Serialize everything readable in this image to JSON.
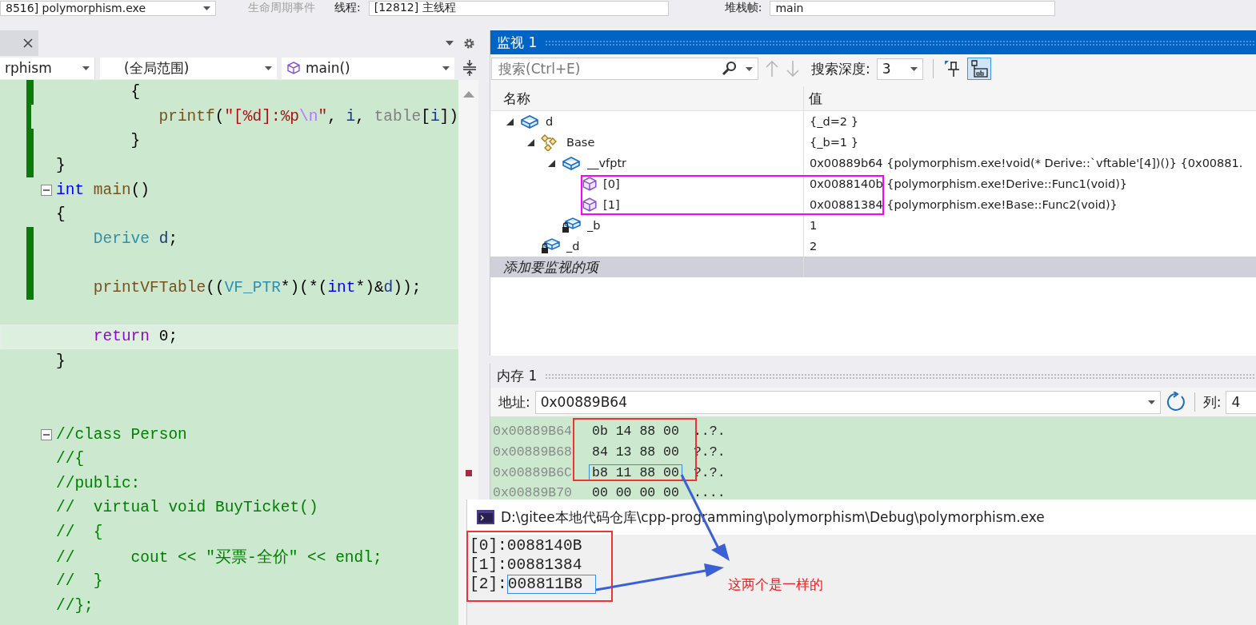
{
  "toolbar": {
    "process": "8516] polymorphism.exe",
    "events": "生命周期事件",
    "thread_label": "线程:",
    "thread": "[12812] 主线程",
    "frame_label": "堆栈帧:",
    "frame": "main"
  },
  "editor": {
    "project": "rphism",
    "scope": "(全局范围)",
    "member": "main()",
    "lines": [
      {
        "changed": true,
        "fold": false,
        "current": false,
        "segments": [
          {
            "kind": "plain",
            "text": "        {"
          }
        ]
      },
      {
        "changed": true,
        "fold": false,
        "current": false,
        "segments": [
          {
            "kind": "fn",
            "text": "            printf"
          },
          {
            "kind": "plain",
            "text": "("
          },
          {
            "kind": "str",
            "text": "\"[%d]:%p"
          },
          {
            "kind": "esc",
            "text": "\\n"
          },
          {
            "kind": "str",
            "text": "\""
          },
          {
            "kind": "plain",
            "text": ", "
          },
          {
            "kind": "ident",
            "text": "i"
          },
          {
            "kind": "plain",
            "text": ", "
          },
          {
            "kind": "field",
            "text": "table"
          },
          {
            "kind": "plain",
            "text": "["
          },
          {
            "kind": "ident",
            "text": "i"
          },
          {
            "kind": "plain",
            "text": "])"
          }
        ]
      },
      {
        "changed": true,
        "fold": false,
        "current": false,
        "segments": [
          {
            "kind": "plain",
            "text": "        }"
          }
        ]
      },
      {
        "changed": true,
        "fold": false,
        "current": false,
        "segments": [
          {
            "kind": "plain",
            "text": "}"
          }
        ]
      },
      {
        "changed": false,
        "fold": true,
        "current": false,
        "segments": [
          {
            "kind": "kw",
            "text": "int"
          },
          {
            "kind": "fn",
            "text": " main"
          },
          {
            "kind": "plain",
            "text": "()"
          }
        ]
      },
      {
        "changed": false,
        "fold": false,
        "current": false,
        "segments": [
          {
            "kind": "plain",
            "text": "{"
          }
        ]
      },
      {
        "changed": true,
        "fold": false,
        "current": false,
        "segments": [
          {
            "kind": "type",
            "text": "    Derive"
          },
          {
            "kind": "ident",
            "text": " d"
          },
          {
            "kind": "plain",
            "text": ";"
          }
        ]
      },
      {
        "changed": true,
        "fold": false,
        "current": false
      },
      {
        "changed": true,
        "fold": false,
        "current": false,
        "segments": [
          {
            "kind": "fn",
            "text": "    printVFTable"
          },
          {
            "kind": "plain",
            "text": "(("
          },
          {
            "kind": "type",
            "text": "VF_PTR"
          },
          {
            "kind": "plain",
            "text": "*)(*("
          },
          {
            "kind": "kw",
            "text": "int"
          },
          {
            "kind": "plain",
            "text": "*)&"
          },
          {
            "kind": "ident",
            "text": "d"
          },
          {
            "kind": "plain",
            "text": "));"
          }
        ]
      },
      {
        "changed": false,
        "fold": false,
        "current": false
      },
      {
        "changed": false,
        "fold": false,
        "current": true,
        "segments": [
          {
            "kind": "ctrl",
            "text": "    return"
          },
          {
            "kind": "plain",
            "text": " 0;"
          }
        ]
      },
      {
        "changed": false,
        "fold": false,
        "current": false,
        "segments": [
          {
            "kind": "plain",
            "text": "}"
          }
        ]
      },
      {
        "changed": false,
        "fold": false,
        "current": false
      },
      {
        "changed": false,
        "fold": false,
        "current": false
      },
      {
        "changed": false,
        "fold": true,
        "current": false,
        "segments": [
          {
            "kind": "comment",
            "text": "//class Person"
          }
        ]
      },
      {
        "changed": false,
        "fold": false,
        "current": false,
        "segments": [
          {
            "kind": "comment",
            "text": "//{"
          }
        ]
      },
      {
        "changed": false,
        "fold": false,
        "current": false,
        "segments": [
          {
            "kind": "comment",
            "text": "//public:"
          }
        ]
      },
      {
        "changed": false,
        "fold": false,
        "current": false,
        "segments": [
          {
            "kind": "comment",
            "text": "//  virtual void BuyTicket()"
          }
        ]
      },
      {
        "changed": false,
        "fold": false,
        "current": false,
        "segments": [
          {
            "kind": "comment",
            "text": "//  {"
          }
        ]
      },
      {
        "changed": false,
        "fold": false,
        "current": false,
        "segments": [
          {
            "kind": "comment",
            "text": "//      cout << \"买票-全价\" << endl;"
          }
        ]
      },
      {
        "changed": false,
        "fold": false,
        "current": false,
        "segments": [
          {
            "kind": "comment",
            "text": "//  }"
          }
        ]
      },
      {
        "changed": false,
        "fold": false,
        "current": false,
        "segments": [
          {
            "kind": "comment",
            "text": "//};"
          }
        ]
      }
    ]
  },
  "watch": {
    "title": "监视 1",
    "search": {
      "placeholder": "搜索(Ctrl+E)"
    },
    "depth_label": "搜索深度:",
    "depth": "3",
    "columns": [
      "名称",
      "值"
    ],
    "rows": [
      {
        "kind": "object",
        "name": "d",
        "value": "{_d=2 }",
        "expanded": true,
        "children": [
          {
            "kind": "base",
            "name": "Base",
            "value": "{_b=1 }",
            "expanded": true,
            "children": [
              {
                "kind": "object",
                "name": "__vfptr",
                "value": "0x00889b64 {polymorphism.exe!void(* Derive::`vftable'[4])()} {0x00881.",
                "expanded": true,
                "children": [
                  {
                    "kind": "method",
                    "name": "[0]",
                    "value": "0x0088140b {polymorphism.exe!Derive::Func1(void)}"
                  },
                  {
                    "kind": "method",
                    "name": "[1]",
                    "value": "0x00881384 {polymorphism.exe!Base::Func2(void)}"
                  }
                ]
              },
              {
                "kind": "field",
                "name": "_b",
                "value": "1"
              }
            ]
          },
          {
            "kind": "field",
            "name": "_d",
            "value": "2"
          }
        ]
      }
    ],
    "add_hint": "添加要监视的项"
  },
  "memory": {
    "title": "内存 1",
    "address_label": "地址:",
    "address": "0x00889B64",
    "columns_label": "列:",
    "columns": "4",
    "rows": [
      {
        "address": "0x00889B64",
        "bytes": "0b 14 88 00",
        "chars": "..?.",
        "selected": false
      },
      {
        "address": "0x00889B68",
        "bytes": "84 13 88 00",
        "chars": "?.?.",
        "selected": false
      },
      {
        "address": "0x00889B6C",
        "bytes": "b8 11 88 00",
        "chars": "?.?.",
        "selected": true
      },
      {
        "address": "0x00889B70",
        "bytes": "00 00 00 00",
        "chars": "....",
        "selected": false
      }
    ]
  },
  "console": {
    "title": "D:\\gitee本地代码仓库\\cpp-programming\\polymorphism\\Debug\\polymorphism.exe",
    "lines": [
      {
        "text": "[0]:0088140B"
      },
      {
        "text": "[1]:00881384"
      },
      {
        "text": "[2]:",
        "selected_text": "008811B8"
      }
    ]
  },
  "annotation": {
    "text": "这两个是一样的"
  }
}
